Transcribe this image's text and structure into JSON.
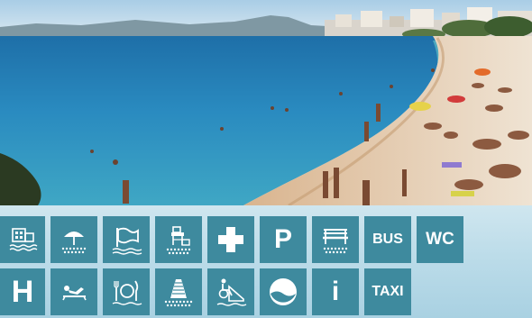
{
  "colors": {
    "tile": "#3e8a9e",
    "icon": "#ffffff",
    "panel": "#bcdce9"
  },
  "photo": {
    "subject": "beach-photo"
  },
  "icons_row_1": [
    {
      "icon": "hotel-icon"
    },
    {
      "icon": "beach-umbrella-icon"
    },
    {
      "icon": "flag-icon"
    },
    {
      "icon": "lifeguard-tower-icon"
    },
    {
      "icon": "first-aid-icon"
    },
    {
      "icon": "parking-icon",
      "text": "P"
    },
    {
      "icon": "bench-icon"
    },
    {
      "icon": "bus-icon",
      "text": "BUS"
    },
    {
      "icon": "wc-icon",
      "text": "WC"
    }
  ],
  "icons_row_2": [
    {
      "icon": "hospital-icon",
      "text": "H"
    },
    {
      "icon": "sunbathing-icon"
    },
    {
      "icon": "restaurant-icon"
    },
    {
      "icon": "walkway-icon"
    },
    {
      "icon": "accessible-ramp-icon"
    },
    {
      "icon": "blue-flag-icon"
    },
    {
      "icon": "information-icon",
      "text": "i"
    },
    {
      "icon": "taxi-icon",
      "text": "TAXI"
    }
  ]
}
